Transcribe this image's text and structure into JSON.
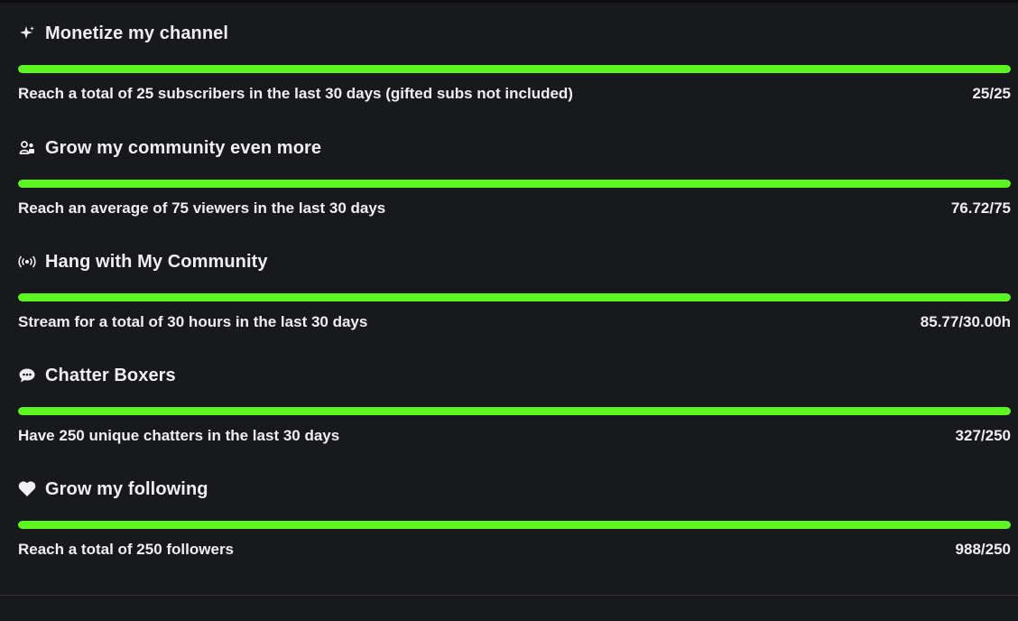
{
  "goals": [
    {
      "icon": "sparkle-icon",
      "title": "Monetize my channel",
      "description": "Reach a total of 25 subscribers in the last 30 days (gifted subs not included)",
      "progress": "25/25",
      "fill_fraction": 1.0
    },
    {
      "icon": "community-icon",
      "title": "Grow my community even more",
      "description": "Reach an average of 75 viewers in the last 30 days",
      "progress": "76.72/75",
      "fill_fraction": 1.0
    },
    {
      "icon": "broadcast-icon",
      "title": "Hang with My Community",
      "description": "Stream for a total of 30 hours in the last 30 days",
      "progress": "85.77/30.00h",
      "fill_fraction": 1.0
    },
    {
      "icon": "chat-bubble-icon",
      "title": "Chatter Boxers",
      "description": "Have 250 unique chatters in the last 30 days",
      "progress": "327/250",
      "fill_fraction": 1.0
    },
    {
      "icon": "heart-icon",
      "title": "Grow my following",
      "description": "Reach a total of 250 followers",
      "progress": "988/250",
      "fill_fraction": 1.0
    }
  ],
  "colors": {
    "background": "#18191c",
    "progress_fill": "#5cf720",
    "text": "#efeff1"
  }
}
